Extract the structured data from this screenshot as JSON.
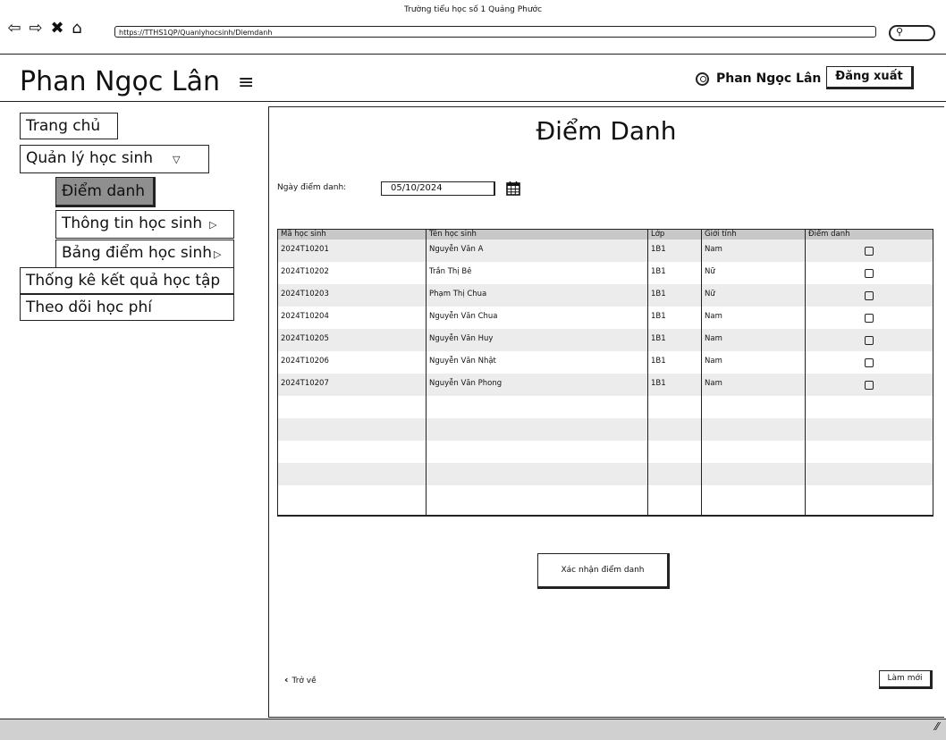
{
  "window": {
    "title": "Trường tiểu học số 1 Quảng Phước",
    "url": "https://TTHS1QP/Quanlyhocsinh/Diemdanh"
  },
  "header": {
    "app_name": "Phan Ngọc Lân",
    "user_name": "Phan Ngọc Lân",
    "logout_label": "Đăng xuất"
  },
  "sidebar": {
    "home": "Trang chủ",
    "students": "Quản lý học sinh",
    "attendance": "Điểm danh",
    "student_info": "Thông tin học sinh",
    "grades": "Bảng điểm học sinh",
    "stats": "Thống kê kết quả học tập",
    "fees": "Theo dõi học phí"
  },
  "main": {
    "title": "Điểm Danh",
    "date_label": "Ngày điểm danh:",
    "date_value": "05/10/2024",
    "columns": [
      "Mã học sinh",
      "Tên học sinh",
      "Lớp",
      "Giới tính",
      "Điểm danh"
    ],
    "rows": [
      [
        "2024T10201",
        "Nguyễn Văn A",
        "1B1",
        "Nam"
      ],
      [
        "2024T10202",
        "Trần Thị Bê",
        "1B1",
        "Nữ"
      ],
      [
        "2024T10203",
        "Phạm Thị Chua",
        "1B1",
        "Nữ"
      ],
      [
        "2024T10204",
        "Nguyễn Văn Chua",
        "1B1",
        "Nam"
      ],
      [
        "2024T10205",
        "Nguyễn Văn Huy",
        "1B1",
        "Nam"
      ],
      [
        "2024T10206",
        "Nguyễn Văn Nhật",
        "1B1",
        "Nam"
      ],
      [
        "2024T10207",
        "Nguyễn Văn Phong",
        "1B1",
        "Nam"
      ]
    ],
    "confirm_label": "Xác nhận điểm danh",
    "back_label": "Trở về",
    "reset_label": "Làm mới"
  }
}
